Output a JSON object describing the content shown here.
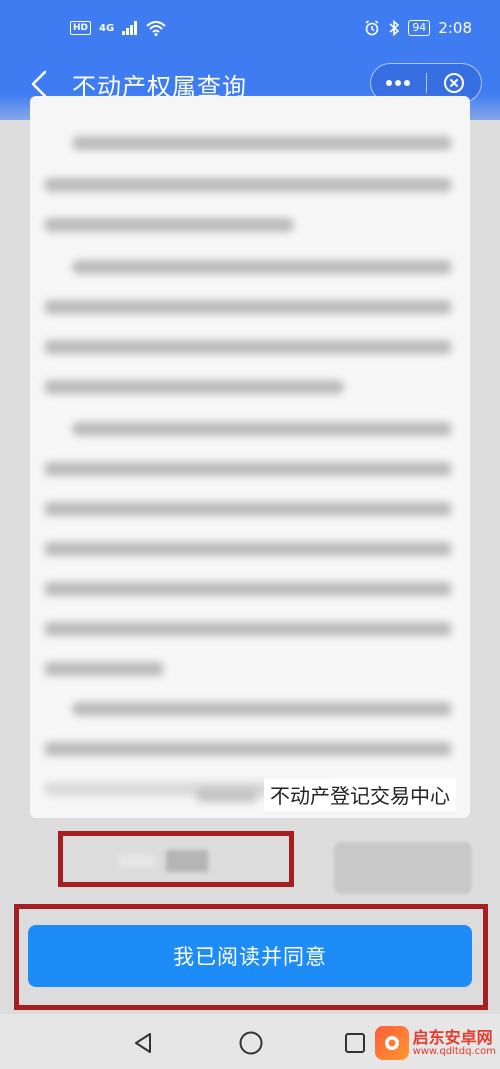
{
  "status_bar": {
    "network_badge": "HD",
    "network_type": "4G",
    "battery": "94",
    "time": "2:08"
  },
  "title_bar": {
    "title": "不动产权属查询",
    "back_icon": "chevron-left-icon",
    "more_icon": "more-dots-icon",
    "close_icon": "close-circle-icon"
  },
  "document": {
    "signature": "不动产登记交易中心"
  },
  "agree_button": {
    "label": "我已阅读并同意"
  },
  "watermark": {
    "title": "启东安卓网",
    "url": "www.qdltdq.com"
  },
  "colors": {
    "header": "#3f7cf2",
    "agree_button": "#1e8cf7",
    "highlight_box": "#a51e22"
  }
}
